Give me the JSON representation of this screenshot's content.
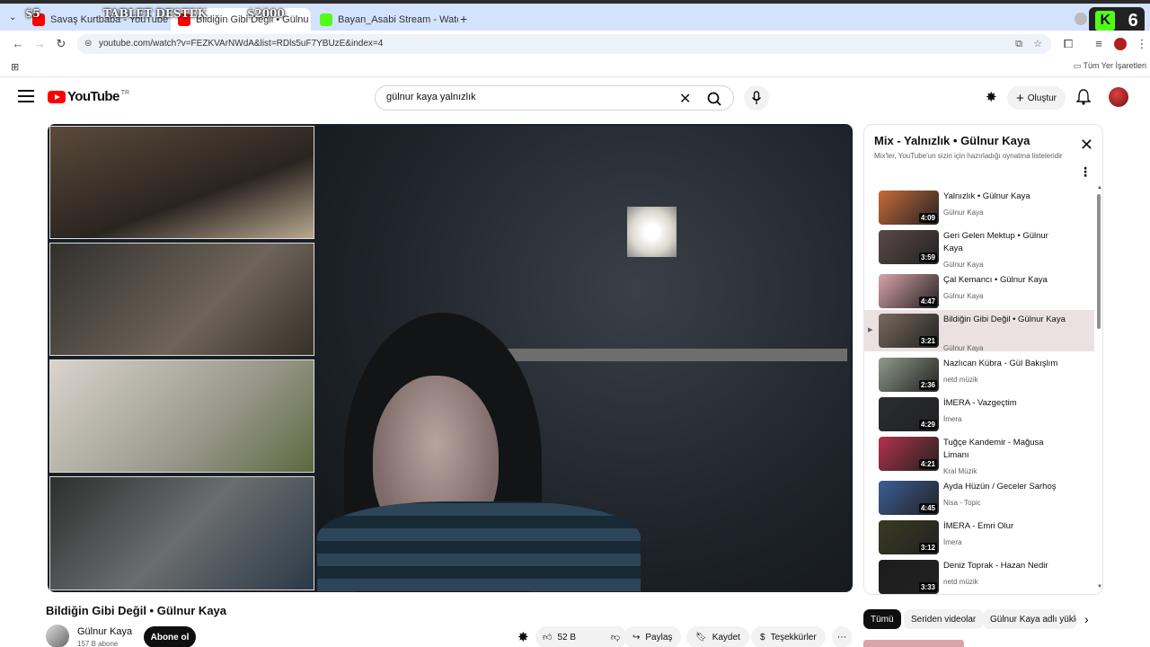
{
  "overlay": {
    "price_left": "$5",
    "banner": "TABLET DESTEK",
    "price_right": "$2000",
    "counter": "6"
  },
  "tabs": [
    {
      "label": "Savaş Kurtbaba - YouTube"
    },
    {
      "label": "Bildiğin Gibi Değil • Gülnu"
    },
    {
      "label": "Bayan_Asabi Stream - Watch Li"
    }
  ],
  "address": {
    "url": "youtube.com/watch?v=FEZKVArNWdA&list=RDls5uF7YBUzE&index=4"
  },
  "bookmarks": {
    "all_bookmarks": "Tüm Yer İşaretleri"
  },
  "youtube": {
    "logo_text": "YouTube",
    "country": "TR",
    "search_query": "gülnur kaya yalnızlık",
    "create_label": "Oluştur"
  },
  "video": {
    "title": "Bildiğin Gibi Değil • Gülnur Kaya",
    "channel": "Gülnur Kaya",
    "subscribers": "157 B abone",
    "subscribe_label": "Abone ol",
    "likes": "52 B",
    "share": "Paylaş",
    "save": "Kaydet",
    "thanks": "Teşekkürler"
  },
  "playlist": {
    "title": "Mix - Yalnızlık • Gülnur Kaya",
    "subtitle": "Mix'ler, YouTube'un sizin için hazırladığı oynatma listeleridir",
    "items": [
      {
        "title": "Yalnızlık • Gülnur Kaya",
        "channel": "Gülnur Kaya",
        "duration": "4:09",
        "color": "#c96a3a"
      },
      {
        "title": "Geri Gelen Mektup • Gülnur Kaya",
        "channel": "Gülnur Kaya",
        "duration": "3:59",
        "color": "#5a4a48"
      },
      {
        "title": "Çal Kemancı • Gülnur Kaya",
        "channel": "Gülnur Kaya",
        "duration": "4:47",
        "color": "#d9a3a8"
      },
      {
        "title": "Bildiğin Gibi Değil • Gülnur Kaya",
        "channel": "Gülnur Kaya",
        "duration": "3:21",
        "color": "#7a6a5e"
      },
      {
        "title": "Nazlıcan Kübra - Gül Bakışlım",
        "channel": "netd müzik",
        "duration": "2:36",
        "color": "#8f9a88"
      },
      {
        "title": "İMERA - Vazgeçtim",
        "channel": "İmera",
        "duration": "4:29",
        "color": "#2a2c30"
      },
      {
        "title": "Tuğçe Kandemir - Mağusa Limanı",
        "channel": "Kral Müzik",
        "duration": "4:21",
        "color": "#b2324a"
      },
      {
        "title": "Ayda Hüzün / Geceler Sarhoş",
        "channel": "Nisa - Topic",
        "duration": "4:45",
        "color": "#3c5e96"
      },
      {
        "title": "İMERA - Emri Olur",
        "channel": "İmera",
        "duration": "3:12",
        "color": "#3a3a22"
      },
      {
        "title": "Deniz Toprak - Hazan Nedir",
        "channel": "netd müzik",
        "duration": "3:33",
        "color": "#1c1c1c"
      }
    ],
    "current_index": 3,
    "chips": [
      "Tümü",
      "Seriden videolar",
      "Gülnur Kaya adlı yükle"
    ]
  }
}
